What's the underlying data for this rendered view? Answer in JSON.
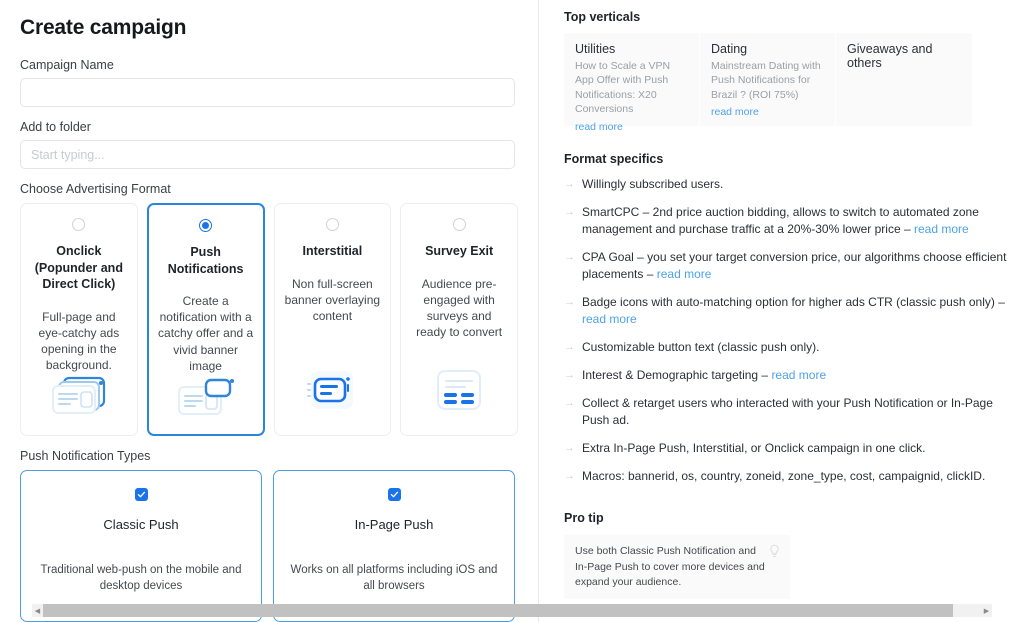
{
  "left": {
    "page_title": "Create campaign",
    "campaign_name": {
      "label": "Campaign Name",
      "value": "",
      "placeholder": ""
    },
    "add_to_folder": {
      "label": "Add to folder",
      "value": "",
      "placeholder": "Start typing..."
    },
    "format_section_label": "Choose Advertising Format",
    "formats": [
      {
        "title": "Onclick (Popunder and Direct Click)",
        "description": "Full-page and eye-catchy ads opening in the background.",
        "selected": false,
        "icon": "stacked-cards-icon"
      },
      {
        "title": "Push Notifications",
        "description": "Create a notification with a catchy offer and a vivid banner image",
        "selected": true,
        "icon": "push-notification-icon"
      },
      {
        "title": "Interstitial",
        "description": "Non full-screen banner overlaying content",
        "selected": false,
        "icon": "interstitial-banner-icon"
      },
      {
        "title": "Survey Exit",
        "description": "Audience pre-engaged with surveys and ready to convert",
        "selected": false,
        "icon": "survey-exit-icon"
      }
    ],
    "push_types_label": "Push Notification Types",
    "push_types": [
      {
        "title": "Classic Push",
        "description": "Traditional web-push on the mobile and desktop devices",
        "checked": true
      },
      {
        "title": "In-Page Push",
        "description": "Works on all platforms including iOS and all browsers",
        "checked": true
      }
    ]
  },
  "right": {
    "top_verticals": {
      "heading": "Top verticals",
      "cards": [
        {
          "title": "Utilities",
          "body": "How to Scale a VPN App Offer with Push Notifications: X20 Conversions",
          "link": "read more"
        },
        {
          "title": "Dating",
          "body": "Mainstream Dating with Push Notifications for Brazil ? (ROI 75%)",
          "link": "read more"
        },
        {
          "title": "Giveaways and others",
          "body": "",
          "link": ""
        }
      ]
    },
    "format_specifics": {
      "heading": "Format specifics",
      "bullet_glyph": "→",
      "items": [
        {
          "text": "Willingly subscribed users.",
          "link": ""
        },
        {
          "text": "SmartCPC – 2nd price auction bidding, allows to switch to automated zone management and purchase traffic at a 20%-30% lower price – ",
          "link": "read more"
        },
        {
          "text": "CPA Goal – you set your target conversion price, our algorithms choose efficient placements – ",
          "link": "read more"
        },
        {
          "text": "Badge icons with auto-matching option for higher ads CTR (classic push only) – ",
          "link": "read more"
        },
        {
          "text": "Customizable button text (classic push only).",
          "link": ""
        },
        {
          "text": "Interest & Demographic targeting – ",
          "link": "read more"
        },
        {
          "text": "Collect & retarget users who interacted with your Push Notification or In-Page Push ad.",
          "link": ""
        },
        {
          "text": "Extra In-Page Push, Interstitial, or Onclick campaign in one click.",
          "link": ""
        },
        {
          "text": "Macros: bannerid, os, country, zoneid, zone_type, cost, campaignid, clickID.",
          "link": ""
        }
      ]
    },
    "pro_tip": {
      "heading": "Pro tip",
      "text": "Use both Classic Push Notification and In-Page Push to cover more devices and expand your audience.",
      "icon": "lightbulb-icon"
    }
  },
  "scrollbar": {
    "left_arrow": "◀",
    "right_arrow": "▶"
  },
  "colors": {
    "accent_blue": "#1a73e8",
    "link_blue": "#4ea2e8",
    "card_border_selected": "#2a86d8",
    "card_bg": "#fafafa"
  }
}
